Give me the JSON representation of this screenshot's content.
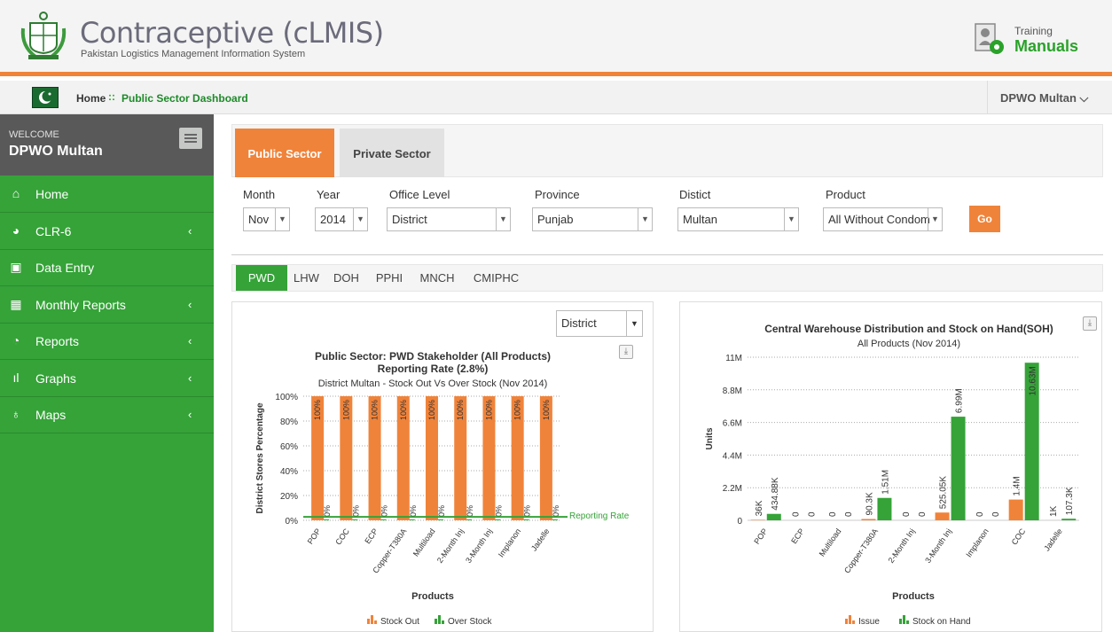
{
  "app": {
    "title": "Contraceptive (cLMIS)",
    "subtitle": "Pakistan Logistics Management Information System",
    "training_top": "Training",
    "training_bottom": "Manuals"
  },
  "breadcrumb": {
    "home": "Home",
    "separator": "::",
    "current": "Public Sector Dashboard"
  },
  "user_menu": {
    "label": "DPWO Multan ⌵"
  },
  "sidebar": {
    "welcome_label": "WELCOME",
    "welcome_name": "DPWO Multan",
    "items": [
      {
        "label": "Home",
        "icon": "home-icon",
        "glyph": "⌂",
        "chevron": ""
      },
      {
        "label": "CLR-6",
        "icon": "pie-icon",
        "glyph": "◕",
        "chevron": "‹"
      },
      {
        "label": "Data Entry",
        "icon": "entry-icon",
        "glyph": "▣",
        "chevron": ""
      },
      {
        "label": "Monthly Reports",
        "icon": "calendar-icon",
        "glyph": "▦",
        "chevron": "‹"
      },
      {
        "label": "Reports",
        "icon": "pie-chart-icon",
        "glyph": "◔",
        "chevron": "‹"
      },
      {
        "label": "Graphs",
        "icon": "bar-chart-icon",
        "glyph": "ıl",
        "chevron": "‹"
      },
      {
        "label": "Maps",
        "icon": "map-pin-icon",
        "glyph": "♁",
        "chevron": "‹"
      }
    ]
  },
  "sector_tabs": {
    "public": "Public Sector",
    "private": "Private Sector"
  },
  "filters": {
    "month": {
      "label": "Month",
      "value": "Nov"
    },
    "year": {
      "label": "Year",
      "value": "2014"
    },
    "office": {
      "label": "Office Level",
      "value": "District"
    },
    "province": {
      "label": "Province",
      "value": "Punjab"
    },
    "district": {
      "label": "Distict",
      "value": "Multan"
    },
    "product": {
      "label": "Product",
      "value": "All Without Condom"
    },
    "go": "Go"
  },
  "stakeholder_tabs": [
    "PWD",
    "LHW",
    "DOH",
    "PPHI",
    "MNCH",
    "CMIPHC"
  ],
  "district_dropdown": "District",
  "colors": {
    "orange": "#f0833a",
    "green": "#35a338",
    "green_dark": "#2aa22a"
  },
  "chart_data": [
    {
      "type": "bar",
      "title": "Public Sector: PWD Stakeholder (All Products)",
      "title2": "Reporting Rate (2.8%)",
      "subtitle": "District Multan - Stock Out Vs Over Stock (Nov 2014)",
      "xlabel": "Products",
      "ylabel": "District Stores Percentage",
      "ylim": [
        0,
        100
      ],
      "yticks": [
        "0%",
        "20%",
        "40%",
        "60%",
        "80%",
        "100%"
      ],
      "categories": [
        "POP",
        "COC",
        "ECP",
        "Copper-T380A",
        "Multiload",
        "2-Month Inj",
        "3-Month Inj",
        "Implanon",
        "Jadelle"
      ],
      "series": [
        {
          "name": "Stock Out",
          "color": "#f0833a",
          "values": [
            100,
            100,
            100,
            100,
            100,
            100,
            100,
            100,
            100
          ],
          "labels": [
            "100%",
            "100%",
            "100%",
            "100%",
            "100%",
            "100%",
            "100%",
            "100%",
            "100%"
          ]
        },
        {
          "name": "Over Stock",
          "color": "#35a338",
          "values": [
            0,
            0,
            0,
            0,
            0,
            0,
            0,
            0,
            0
          ],
          "labels": [
            "0%",
            "0%",
            "0%",
            "0%",
            "0%",
            "0%",
            "0%",
            "0%",
            "0%"
          ]
        }
      ],
      "reference_line": {
        "label": "Reporting Rate",
        "value": 2.8
      },
      "legend": "bottom"
    },
    {
      "type": "bar",
      "title": "Central Warehouse Distribution and Stock on Hand(SOH)",
      "subtitle": "All Products (Nov 2014)",
      "xlabel": "Products",
      "ylabel": "Units",
      "ylim": [
        0,
        11000000
      ],
      "yticks": [
        "0",
        "2.2M",
        "4.4M",
        "6.6M",
        "8.8M",
        "11M"
      ],
      "categories": [
        "POP",
        "ECP",
        "Multiload",
        "Copper-T380A",
        "2-Month Inj",
        "3-Month Inj",
        "Implanon",
        "COC",
        "Jadelle"
      ],
      "series": [
        {
          "name": "Issue",
          "color": "#f0833a",
          "values": [
            36000,
            0,
            0,
            90300,
            0,
            525050,
            0,
            1400000,
            1000
          ],
          "labels": [
            "36K",
            "0",
            "0",
            "90.3K",
            "0",
            "525.05K",
            "0",
            "1.4M",
            "1K"
          ]
        },
        {
          "name": "Stock on Hand",
          "color": "#35a338",
          "values": [
            434880,
            0,
            0,
            1510000,
            0,
            6990000,
            0,
            10630000,
            107300
          ],
          "labels": [
            "434.88K",
            "0",
            "0",
            "1.51M",
            "0",
            "6.99M",
            "0",
            "10.63M",
            "107.3K"
          ]
        }
      ],
      "legend": "bottom"
    }
  ]
}
